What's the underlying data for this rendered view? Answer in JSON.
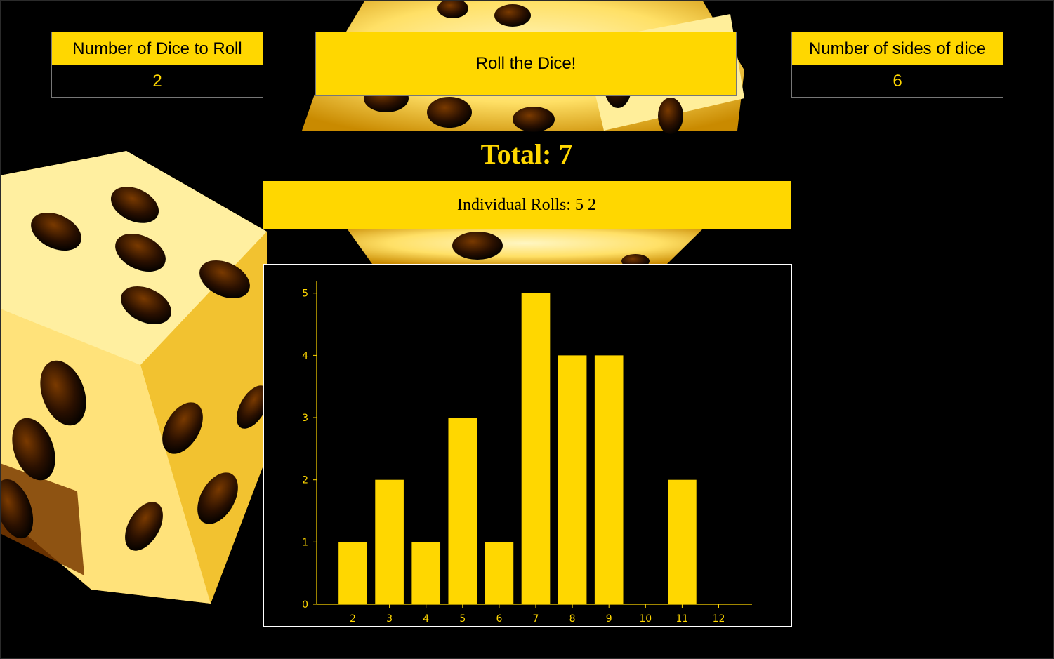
{
  "controls": {
    "dice_count_label": "Number of Dice to Roll",
    "dice_count_value": "2",
    "roll_button_label": "Roll the Dice!",
    "sides_label": "Number of sides of dice",
    "sides_value": "6"
  },
  "results": {
    "total_text": "Total: 7",
    "individual_rolls_text": "Individual Rolls: 5 2"
  },
  "colors": {
    "accent": "#FFD700",
    "background": "#000000",
    "dice_light": "#FFF3B0",
    "dice_dark": "#C88A00"
  },
  "chart_data": {
    "type": "bar",
    "categories": [
      "2",
      "3",
      "4",
      "5",
      "6",
      "7",
      "8",
      "9",
      "10",
      "11",
      "12"
    ],
    "values": [
      1,
      2,
      1,
      3,
      1,
      5,
      4,
      4,
      0,
      2,
      0
    ],
    "yticks": [
      0,
      1,
      2,
      3,
      4,
      5
    ],
    "ylim": [
      0,
      5.2
    ],
    "grid": false,
    "bar_color": "#FFD700",
    "axis_color": "#FFD700"
  }
}
